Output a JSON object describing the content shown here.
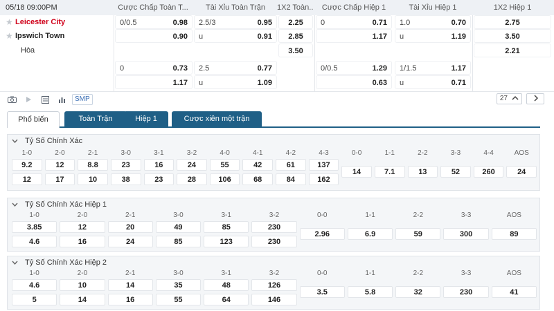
{
  "match": {
    "datetime": "05/18 09:00PM",
    "home": "Leicester City",
    "away": "Ipswich Town",
    "draw": "Hòa"
  },
  "headers": [
    "Cược Chấp Toàn T...",
    "Tài Xỉu Toàn Trận",
    "1X2 Toàn...",
    "Cược Chấp Hiệp 1",
    "Tài Xỉu Hiệp 1",
    "1X2 Hiệp 1"
  ],
  "rows": [
    {
      "hcp_ft": {
        "l": "0/0.5",
        "r": "0.98"
      },
      "ou_ft": {
        "l": "2.5/3",
        "r": "0.95"
      },
      "x12_ft": "2.25",
      "hcp_h1": {
        "l": "0",
        "r": "0.71"
      },
      "ou_h1": {
        "l": "1.0",
        "r": "0.70"
      },
      "x12_h1": "2.75"
    },
    {
      "hcp_ft": {
        "l": "",
        "r": "0.90"
      },
      "ou_ft": {
        "l": "u",
        "r": "0.91"
      },
      "x12_ft": "2.85",
      "hcp_h1": {
        "l": "",
        "r": "1.17"
      },
      "ou_h1": {
        "l": "u",
        "r": "1.19"
      },
      "x12_h1": "3.50"
    },
    {
      "x12_ft": "3.50",
      "x12_h1": "2.21"
    },
    {
      "hcp_ft": {
        "l": "0",
        "r": "0.73"
      },
      "ou_ft": {
        "l": "2.5",
        "r": "0.77"
      },
      "hcp_h1": {
        "l": "0/0.5",
        "r": "1.29"
      },
      "ou_h1": {
        "l": "1/1.5",
        "r": "1.17"
      }
    },
    {
      "hcp_ft": {
        "l": "",
        "r": "1.17"
      },
      "ou_ft": {
        "l": "u",
        "r": "1.09"
      },
      "hcp_h1": {
        "l": "",
        "r": "0.63"
      },
      "ou_h1": {
        "l": "u",
        "r": "0.71"
      }
    }
  ],
  "toolbar": {
    "smp": "SMP",
    "page": "27"
  },
  "tabs": [
    "Phổ biến",
    "Toàn Trận",
    "Hiệp 1",
    "Cược xiên một trận"
  ],
  "sections": [
    {
      "title": "Tỷ Số Chính Xác",
      "labels": [
        "1-0",
        "2-0",
        "2-1",
        "3-0",
        "3-1",
        "3-2",
        "4-0",
        "4-1",
        "4-2",
        "4-3",
        "0-0",
        "1-1",
        "2-2",
        "3-3",
        "4-4",
        "AOS"
      ],
      "home": [
        "9.2",
        "12",
        "8.8",
        "23",
        "16",
        "24",
        "55",
        "42",
        "61",
        "137"
      ],
      "away": [
        "12",
        "17",
        "10",
        "38",
        "23",
        "28",
        "106",
        "68",
        "84",
        "162"
      ],
      "mid": [
        "14",
        "7.1",
        "13",
        "52",
        "260",
        "24"
      ]
    },
    {
      "title": "Tỷ Số Chính Xác Hiệp 1",
      "labels": [
        "1-0",
        "2-0",
        "2-1",
        "3-0",
        "3-1",
        "3-2",
        "0-0",
        "1-1",
        "2-2",
        "3-3",
        "AOS"
      ],
      "home": [
        "3.85",
        "12",
        "20",
        "49",
        "85",
        "230"
      ],
      "away": [
        "4.6",
        "16",
        "24",
        "85",
        "123",
        "230"
      ],
      "mid": [
        "2.96",
        "6.9",
        "59",
        "300",
        "89"
      ]
    },
    {
      "title": "Tỷ Số Chính Xác Hiệp 2",
      "labels": [
        "1-0",
        "2-0",
        "2-1",
        "3-0",
        "3-1",
        "3-2",
        "0-0",
        "1-1",
        "2-2",
        "3-3",
        "AOS"
      ],
      "home": [
        "4.6",
        "10",
        "14",
        "35",
        "48",
        "126"
      ],
      "away": [
        "5",
        "14",
        "16",
        "55",
        "64",
        "146"
      ],
      "mid": [
        "3.5",
        "5.8",
        "32",
        "230",
        "41"
      ]
    }
  ]
}
